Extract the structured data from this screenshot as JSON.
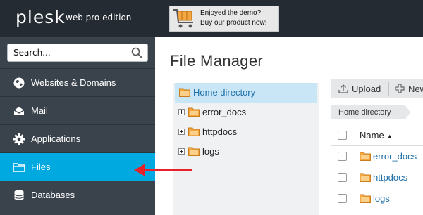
{
  "header": {
    "logo": "plesk",
    "edition": "web pro edition",
    "promo": {
      "line1": "Enjoyed the demo?",
      "line2": "Buy our product now!",
      "icon": "shopping-cart-icon"
    }
  },
  "sidebar": {
    "search": {
      "value": "Search...",
      "icon": "search-icon"
    },
    "items": [
      {
        "label": "Websites & Domains",
        "icon": "globe-icon",
        "active": false
      },
      {
        "label": "Mail",
        "icon": "mail-icon",
        "active": false
      },
      {
        "label": "Applications",
        "icon": "gear-icon",
        "active": false
      },
      {
        "label": "Files",
        "icon": "folder-icon",
        "active": true
      },
      {
        "label": "Databases",
        "icon": "database-icon",
        "active": false
      }
    ]
  },
  "main": {
    "title": "File Manager",
    "tree": [
      {
        "label": "Home directory",
        "selected": true
      },
      {
        "label": "error_docs",
        "selected": false
      },
      {
        "label": "httpdocs",
        "selected": false
      },
      {
        "label": "logs",
        "selected": false
      }
    ],
    "toolbar": {
      "upload": "Upload",
      "new": "New"
    },
    "breadcrumb": "Home directory",
    "columns": {
      "name": "Name"
    },
    "files": [
      "error_docs",
      "httpdocs",
      "logs"
    ]
  },
  "colors": {
    "topbar": "#242b32",
    "sidebar": "#3a434c",
    "accent": "#00a9e0",
    "link": "#1f6fa8",
    "folder": "#f4a640",
    "annotation_arrow": "#e8202a"
  }
}
